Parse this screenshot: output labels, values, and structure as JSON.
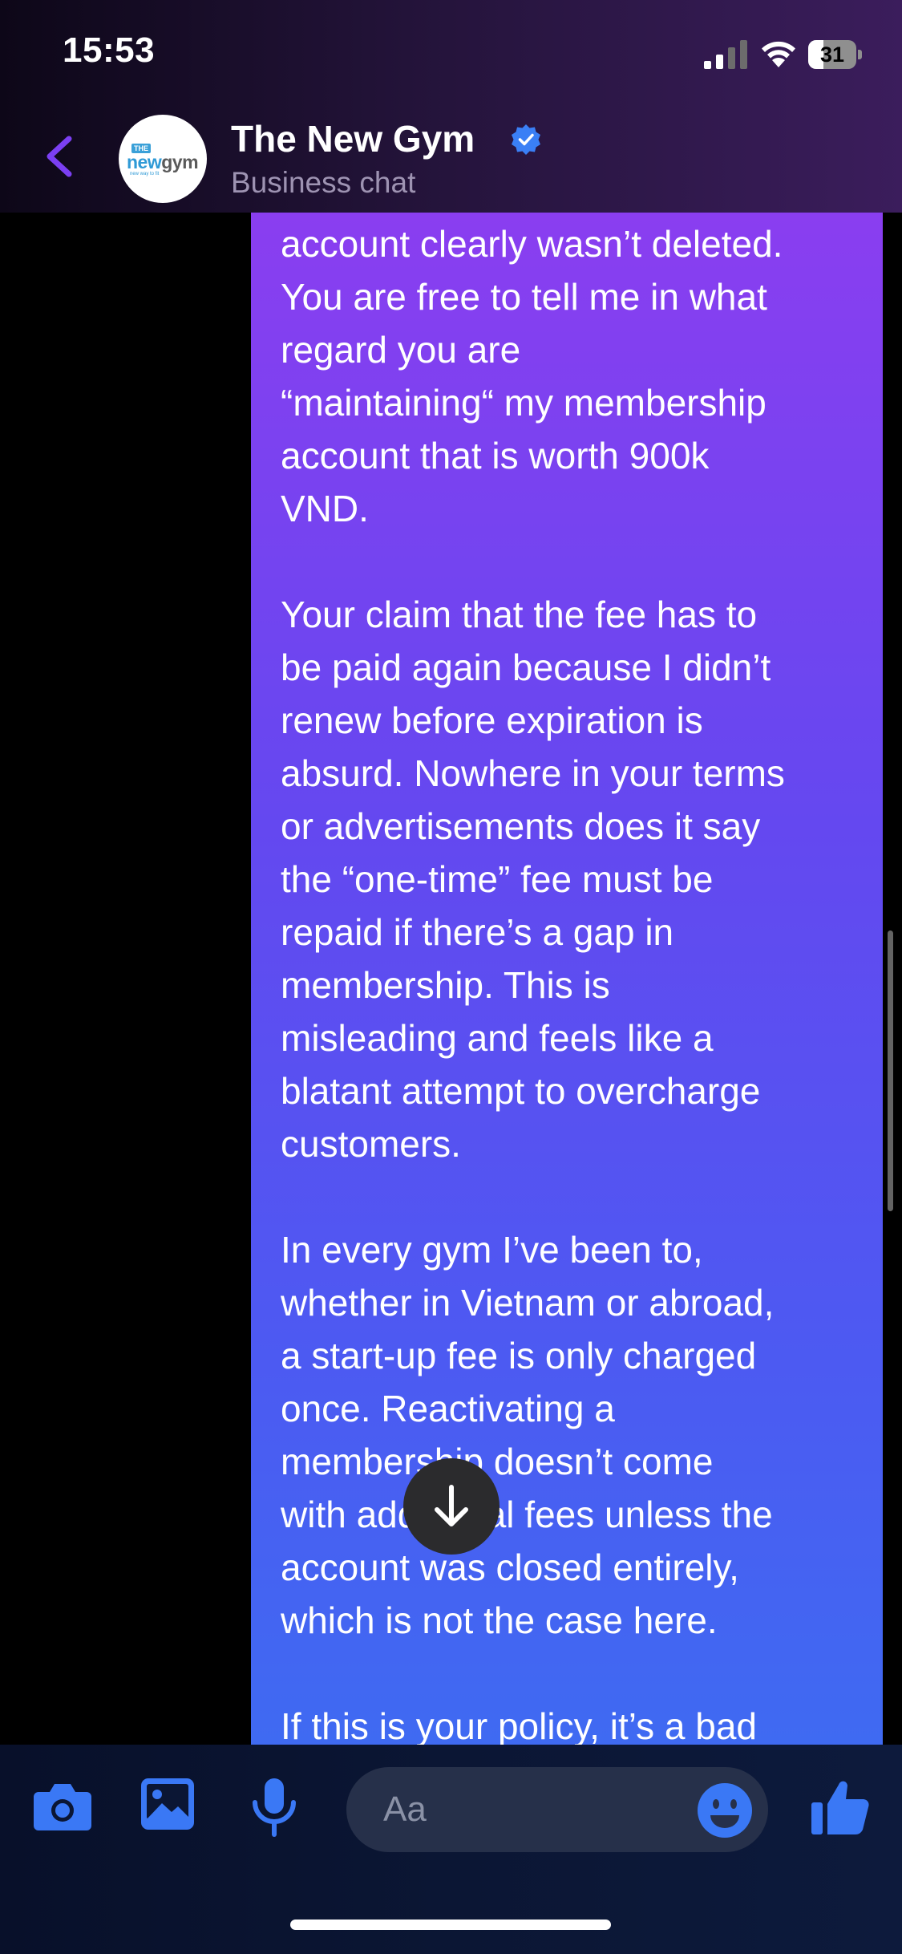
{
  "status_bar": {
    "time": "15:53",
    "battery_level": "31",
    "battery_fraction": 0.31
  },
  "header": {
    "contact_name": "The New Gym",
    "subtitle": "Business chat",
    "verified": true,
    "avatar": {
      "small_text": "THE",
      "logo_part1": "new",
      "logo_part2": "gym",
      "tagline": "new way to fit"
    },
    "icons": {
      "back": "chevron-left-icon",
      "verified": "verified-badge-icon"
    }
  },
  "message": {
    "text": "account clearly wasn’t deleted.\nYou are free to tell me in what\nregard you are\n“maintaining“ my membership\naccount that is worth 900k\nVND.\n\nYour claim that the fee has to\nbe paid again because I didn’t\nrenew before expiration is\nabsurd. Nowhere in your terms\nor advertisements does it say\nthe “one-time” fee must be\nrepaid if there’s a gap in\nmembership. This is\nmisleading and feels like a\nblatant attempt to overcharge\ncustomers.\n\nIn every gym I’ve been to,\nwhether in Vietnam or abroad,\na start-up fee is only charged\nonce. Reactivating a\nmembership doesn’t come\nwith additional fees unless the\naccount was closed entirely,\nwhich is not the case here.\n\nIf this is your policy, it’s a bad",
    "direction": "outgoing"
  },
  "composer": {
    "placeholder": "Aa",
    "icons": [
      "camera-icon",
      "image-icon",
      "microphone-icon",
      "emoji-icon",
      "thumbs-up-icon"
    ]
  },
  "colors": {
    "accent": "#7b3ff2",
    "bubble_top": "#8a3ef0",
    "bubble_bottom": "#3f6af2",
    "composer_icons": "#3a78f5",
    "header_subtitle": "#9e93b2"
  }
}
